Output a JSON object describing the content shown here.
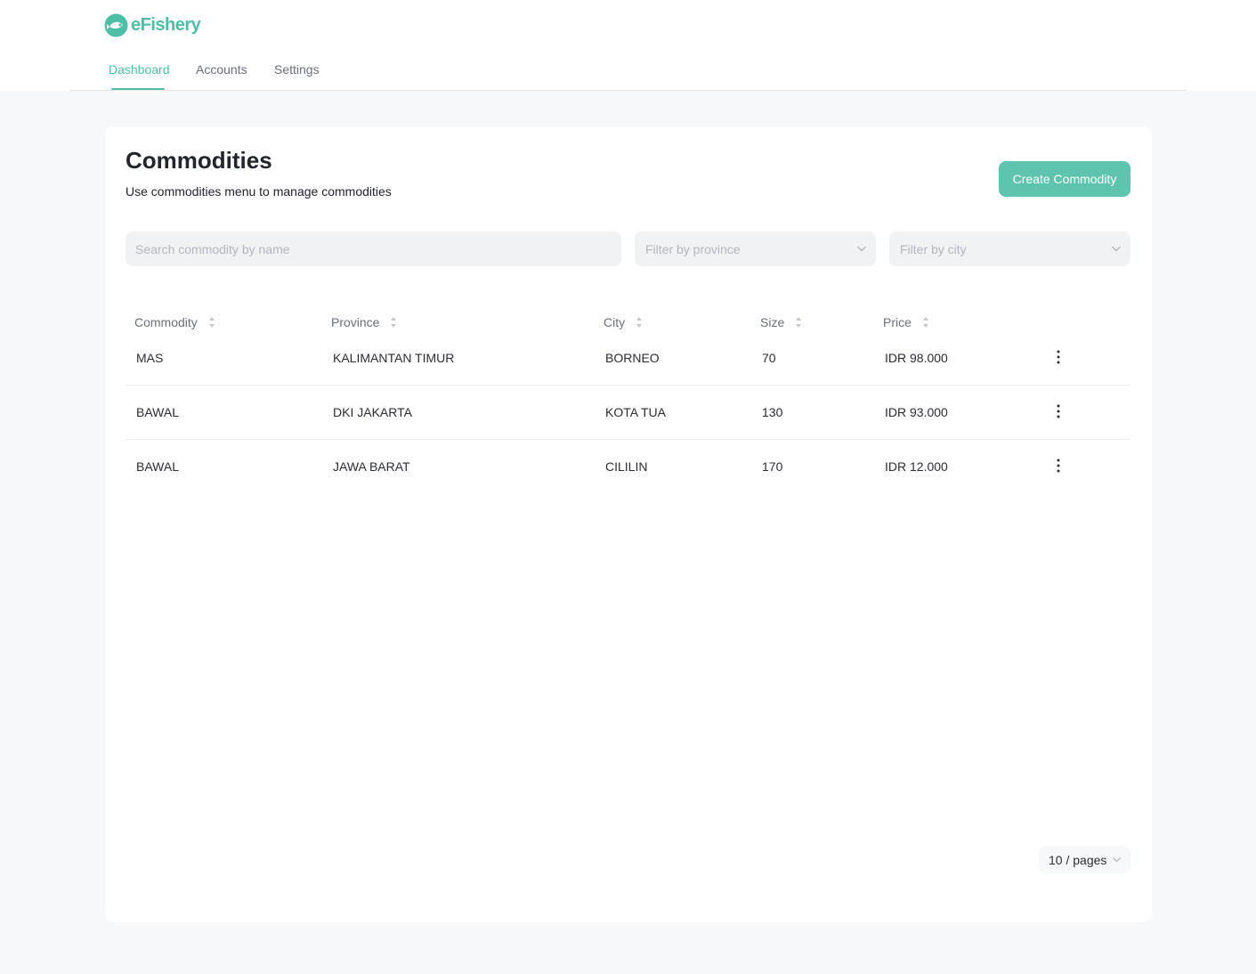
{
  "brand": {
    "name": "eFishery",
    "color": "#4ebfa6"
  },
  "nav": {
    "tabs": [
      {
        "label": "Dashboard",
        "active": true
      },
      {
        "label": "Accounts",
        "active": false
      },
      {
        "label": "Settings",
        "active": false
      }
    ]
  },
  "page": {
    "title": "Commodities",
    "subtitle": "Use commodities menu to manage commodities",
    "create_button": "Create Commodity"
  },
  "filters": {
    "search_placeholder": "Search commodity by name",
    "province_placeholder": "Filter by province",
    "city_placeholder": "Filter by city"
  },
  "table": {
    "columns": [
      "Commodity",
      "Province",
      "City",
      "Size",
      "Price"
    ],
    "rows": [
      [
        "MAS",
        "KALIMANTAN TIMUR",
        "BORNEO",
        "70",
        "IDR 98.000"
      ],
      [
        "BAWAL",
        "DKI JAKARTA",
        "KOTA TUA",
        "130",
        "IDR 93.000"
      ],
      [
        "BAWAL",
        "JAWA BARAT",
        "CILILIN",
        "170",
        "IDR 12.000"
      ]
    ]
  },
  "pagination": {
    "page_size_label": "10 / pages"
  },
  "icons": {
    "sort": "sort-icon",
    "chevron": "chevron-down-icon",
    "row_menu": "kebab-menu-icon"
  }
}
